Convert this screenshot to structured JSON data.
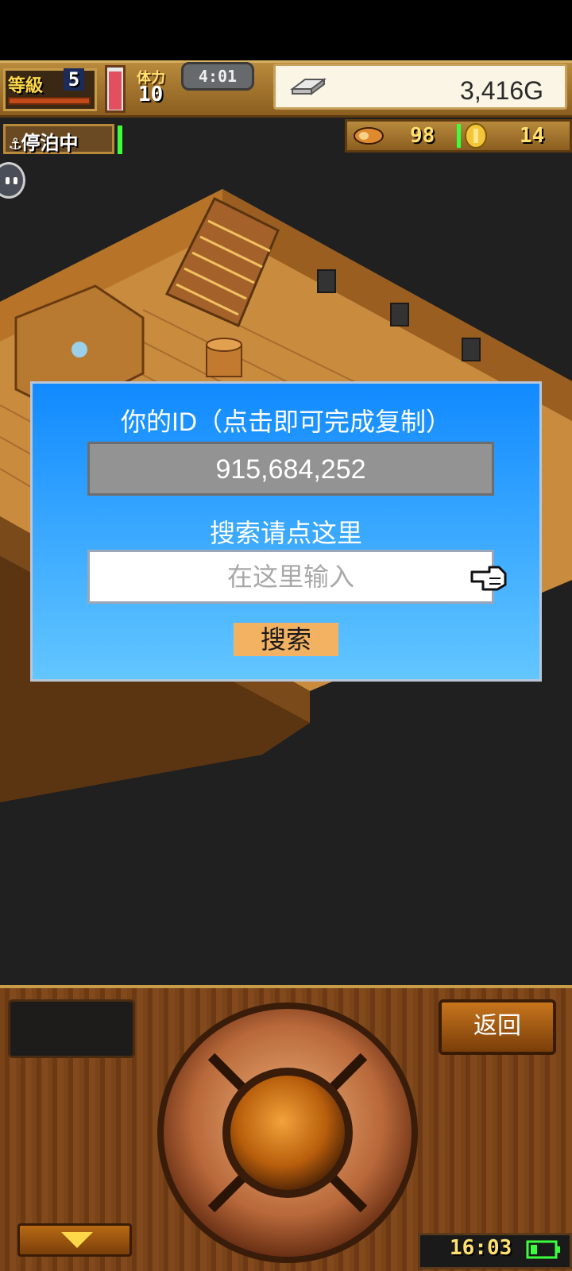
{
  "hud": {
    "level_label": "等級",
    "level_value": "5",
    "stamina_label": "体力",
    "stamina_value": "10",
    "clock": "4:01",
    "money": "3,416G",
    "status": "停泊中",
    "food_value": "98",
    "coin_value": "14"
  },
  "dialog": {
    "title": "你的ID（点击即可完成复制）",
    "id_value": "915,684,252",
    "search_hint": "搜索请点这里",
    "search_placeholder": "在这里输入",
    "search_button": "搜索"
  },
  "controls": {
    "back_label": "返回",
    "time": "16:03"
  },
  "icons": {
    "money": "silver-bar-icon",
    "food": "food-icon",
    "coin": "gold-coin-icon",
    "anchor": "anchor-icon",
    "pointer": "pointer-hand-icon",
    "battery": "battery-icon"
  },
  "colors": {
    "dialog_top": "#118aff",
    "dialog_bottom": "#62c6ff",
    "search_button": "#f2b262",
    "hud_gold": "#ffe070",
    "indicator_green": "#3cff3c"
  }
}
